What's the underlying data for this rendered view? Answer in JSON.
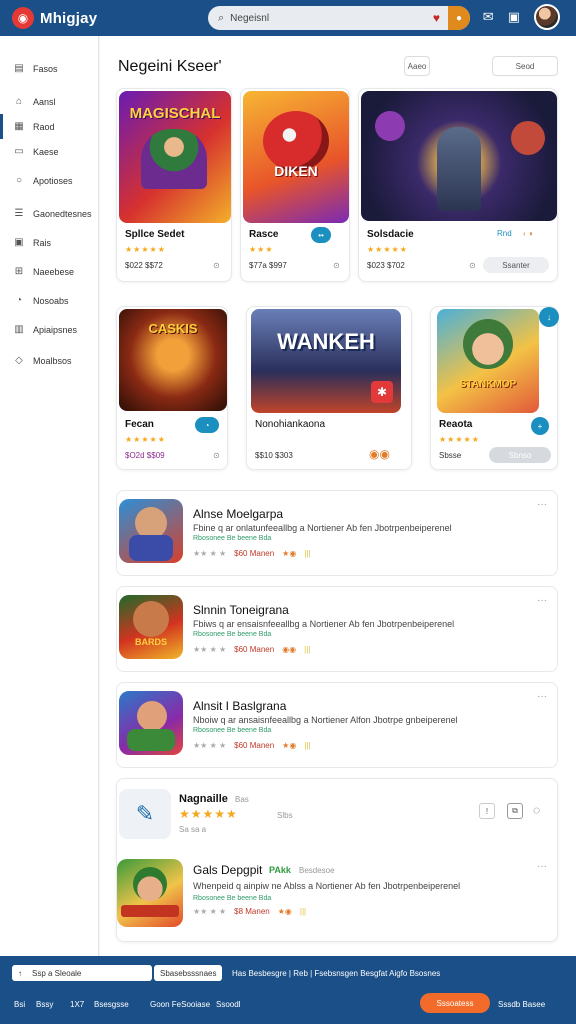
{
  "app": {
    "logo_text": "Mhigjay"
  },
  "search": {
    "value": "Negeisnl"
  },
  "sidebar": {
    "items": [
      {
        "label": "Fasos",
        "icon": "grid-icon"
      },
      {
        "label": "Aansl",
        "icon": "home-icon"
      },
      {
        "label": "Raod",
        "icon": "store-icon"
      },
      {
        "label": "Kaese",
        "icon": "bookmark-icon"
      },
      {
        "label": "Apotioses",
        "icon": "bell-icon"
      },
      {
        "label": "Gaonedtesnes",
        "icon": "list-icon"
      },
      {
        "label": "Rais",
        "icon": "image-icon"
      },
      {
        "label": "Naeebese",
        "icon": "apps-icon"
      },
      {
        "label": "Nosoabs",
        "icon": "mic-icon"
      },
      {
        "label": "Apiaipsnes",
        "icon": "calendar-icon"
      },
      {
        "label": "Moalbsos",
        "icon": "tag-icon"
      }
    ]
  },
  "main": {
    "title": "Negeini Kseer'",
    "chip_left": "Aaeo",
    "chip_right": "Seod"
  },
  "featured": [
    {
      "title": "Spllce Sedet",
      "stars": "★★★★★",
      "price": "$022  $$72",
      "art": "MAGISCHAL",
      "badge": ""
    },
    {
      "title": "Rasce",
      "stars": "★★★",
      "price": "$77a  $997",
      "art": "DIKEN",
      "badge": ""
    },
    {
      "title": "Solsdacie",
      "stars": "★★★★★",
      "price": "$023  $702",
      "art": "",
      "badge": "Rnd",
      "pill": "Ssanter"
    },
    {
      "title": "Fecan",
      "stars": "★★★★★",
      "price": "$O2d  $$09",
      "art": "CASKIS",
      "badge": ""
    },
    {
      "title": "Nonohiankaona",
      "stars": "",
      "price": "$$10  $303",
      "art": "WANKEH",
      "badge": ""
    },
    {
      "title": "Reaota",
      "stars": "★★★★★",
      "price": "Sbsse",
      "art": "STANKMOP",
      "badge": "",
      "pill": "Sbnso"
    }
  ],
  "list": [
    {
      "title": "Alnse Moelgarpa",
      "desc": "Fbine q ar onlatunfeeallbg a Nortiener Ab fen Jbotrpenbeiperenel",
      "tags": "Rbosonee Be beene Bda",
      "stars": "★★  ★  ★",
      "meta": "$60 Manen"
    },
    {
      "title": "Slnnin Toneigrana",
      "desc": "Fbiws q ar ensaisnfeeallbg a Nortiener Ab fen Jbotrpenbeiperenel",
      "tags": "Rbosonee Be beene Bda",
      "stars": "★★  ★  ★",
      "meta": "$60 Manen"
    },
    {
      "title": "Alnsit I Baslgrana",
      "desc": "Nboiw q ar ansaisnfeeallbg a Nortiener Alfon Jbotrpe gnbeiperenel",
      "tags": "Rbosonee Be beene Bda",
      "stars": "★★  ★  ★",
      "meta": "$60 Manen"
    }
  ],
  "review": {
    "title": "Nagnaille",
    "sub": "Bas",
    "stars": "★★★★★",
    "count": "Slbs",
    "foot": "Sa sa a"
  },
  "review_item": {
    "title": "Gals Depgpit",
    "badge": "PAkk",
    "tag": "Besdesoe",
    "desc": "Whenpeid q ainpiw ne Ablss a Nortiener Ab fen Jbotrpenbeiperenel",
    "tags": "Rbosonee Be beene Bda",
    "stars": "★★  ★  ★",
    "meta": "$8 Manen"
  },
  "bottombar": {
    "input1": "Ssp a Sleoale",
    "input2": "Sbasebsssnaes",
    "links": "Has Besbesgre | Reb | Fsebsnsgen  Besgfat Aigfo  Bsosnes",
    "row2_a": "Bsi",
    "row2_b": "Bssy",
    "row2_c": "1X7",
    "row2_d": "Bsesgsse",
    "row2_e": "Goon FeSooiase",
    "row2_f": "Ssoodl",
    "cta": "Sssoatess",
    "right_text": "Sssdb Basee"
  }
}
